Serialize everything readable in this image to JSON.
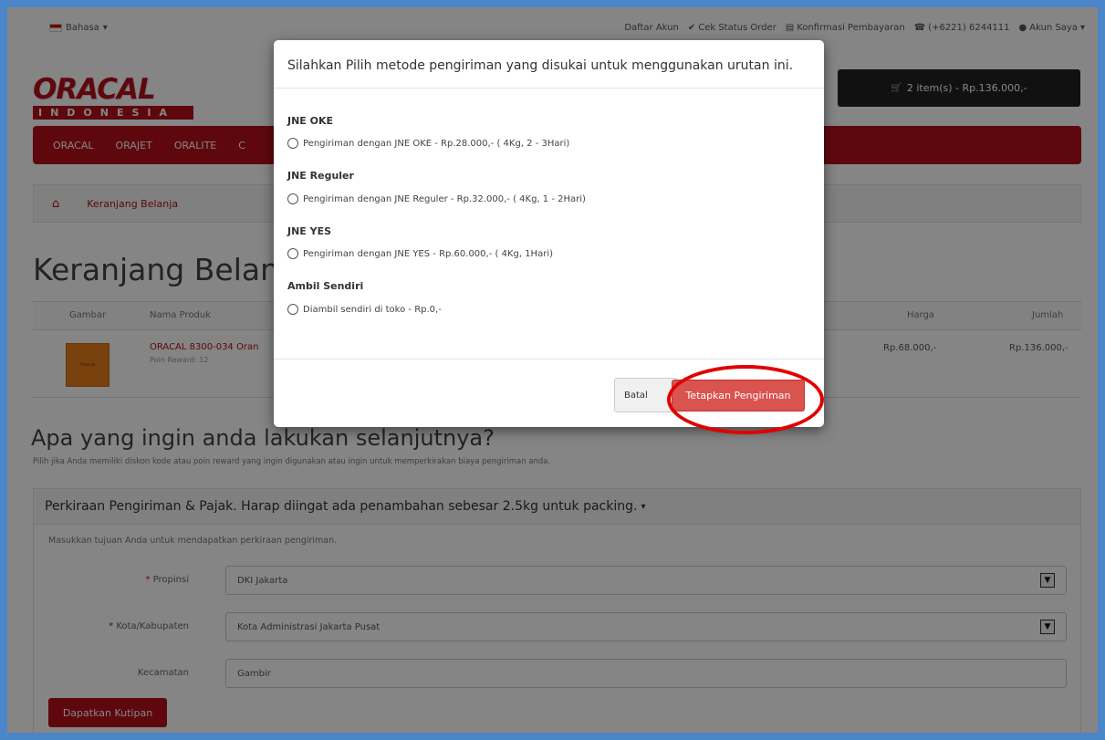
{
  "topbar": {
    "language": "Bahasa",
    "links": [
      "Daftar Akun",
      "Cek Status Order",
      "Konfirmasi Pembayaran",
      "(+6221) 6244111",
      "Akun Saya"
    ]
  },
  "brand": {
    "name_top": "ORACAL",
    "name_bottom": "INDONESIA"
  },
  "cart_button": "2 item(s) - Rp.136.000,-",
  "nav": [
    "ORACAL",
    "ORAJET",
    "ORALITE",
    "C"
  ],
  "breadcrumb": {
    "current": "Keranjang Belanja"
  },
  "page_title": "Keranjang Belanja",
  "table": {
    "headers": {
      "image": "Gambar",
      "name": "Nama Produk",
      "price": "Harga",
      "total": "Jumlah"
    },
    "row": {
      "thumb_label": "Oracal",
      "name": "ORACAL 8300-034 Oran",
      "reward": "Poin Reward: 12",
      "price": "Rp.68.000,-",
      "total": "Rp.136.000,-"
    }
  },
  "next_section": {
    "heading": "Apa yang ingin anda lakukan selanjutnya?",
    "text": "Pilih jika Anda memiliki diskon kode atau poin reward yang ingin digunakan atau ingin untuk memperkirakan biaya pengiriman anda."
  },
  "shipping_panel": {
    "title": "Perkiraan Pengiriman & Pajak. Harap diingat ada penambahan sebesar 2.5kg untuk packing.",
    "hint": "Masukkan tujuan Anda untuk mendapatkan perkiraan pengiriman.",
    "province_label": "Propinsi",
    "province_value": "DKI Jakarta",
    "city_label": "Kota/Kabupaten",
    "city_value": "Kota Administrasi Jakarta Pusat",
    "district_label": "Kecamatan",
    "district_value": "Gambir",
    "quote_button": "Dapatkan Kutipan"
  },
  "modal": {
    "title": "Silahkan Pilih metode pengiriman yang disukai untuk menggunakan urutan ini.",
    "groups": [
      {
        "title": "JNE OKE",
        "option": "Pengiriman dengan JNE OKE - Rp.28.000,- ( 4Kg, 2 - 3Hari)"
      },
      {
        "title": "JNE Reguler",
        "option": "Pengiriman dengan JNE Reguler - Rp.32.000,- ( 4Kg, 1 - 2Hari)"
      },
      {
        "title": "JNE YES",
        "option": "Pengiriman dengan JNE YES - Rp.60.000,- ( 4Kg, 1Hari)"
      },
      {
        "title": "Ambil Sendiri",
        "option": "Diambil sendiri di toko - Rp.0,-"
      }
    ],
    "cancel_button": "Batal",
    "apply_button": "Tetapkan Pengiriman"
  },
  "colors": {
    "brand_red": "#b5101a",
    "apply_button": "#d9534f",
    "highlight_ring": "#e00000",
    "frame_border": "#4a86c8"
  }
}
